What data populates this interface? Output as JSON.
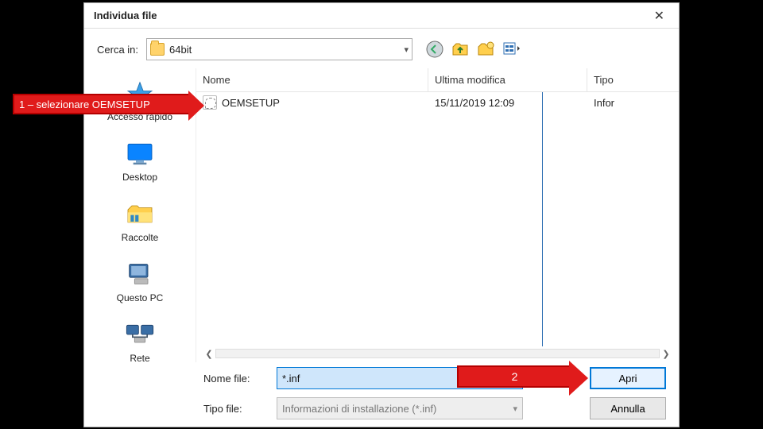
{
  "title": "Individua file",
  "search_label": "Cerca in:",
  "current_folder": "64bit",
  "places": {
    "quick_access": "Accesso rapido",
    "desktop": "Desktop",
    "libraries": "Raccolte",
    "this_pc": "Questo PC",
    "network": "Rete"
  },
  "columns": {
    "name": "Nome",
    "modified": "Ultima modifica",
    "type": "Tipo"
  },
  "rows": [
    {
      "name": "OEMSETUP",
      "modified": "15/11/2019 12:09",
      "type": "Infor"
    }
  ],
  "filename_label": "Nome file:",
  "filename_value": "*.inf",
  "filetype_label": "Tipo file:",
  "filetype_value": "Informazioni di installazione (*.inf)",
  "open_label": "Apri",
  "cancel_label": "Annulla",
  "annotation1": "1 – selezionare OEMSETUP",
  "annotation2": "2"
}
